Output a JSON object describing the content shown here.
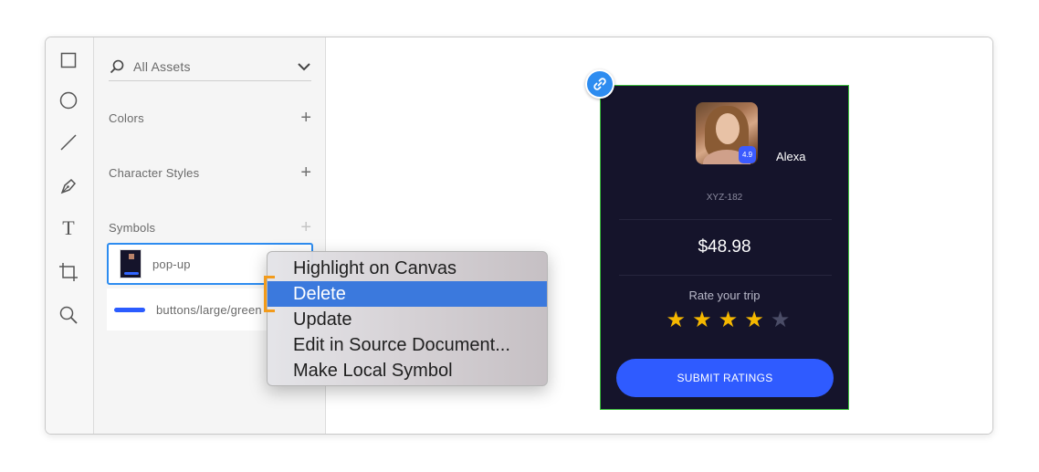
{
  "toolbar": {
    "tools": [
      {
        "name": "rectangle-tool",
        "icon": "rectangle-icon"
      },
      {
        "name": "ellipse-tool",
        "icon": "ellipse-icon"
      },
      {
        "name": "line-tool",
        "icon": "line-icon"
      },
      {
        "name": "pen-tool",
        "icon": "pen-icon"
      },
      {
        "name": "text-tool",
        "icon": "text-icon"
      },
      {
        "name": "artboard-tool",
        "icon": "artboard-icon"
      },
      {
        "name": "zoom-tool",
        "icon": "zoom-icon"
      }
    ],
    "text_tool_glyph": "T"
  },
  "assets": {
    "search_label": "All Assets",
    "colors_title": "Colors",
    "character_styles_title": "Character Styles",
    "symbols_title": "Symbols",
    "add_glyph": "+",
    "symbols": [
      {
        "name": "pop-up"
      },
      {
        "name": "buttons/large/green"
      }
    ]
  },
  "context_menu": {
    "items": [
      {
        "label": "Highlight on Canvas"
      },
      {
        "label": "Delete"
      },
      {
        "label": "Update"
      },
      {
        "label": "Edit in Source Document..."
      },
      {
        "label": "Make Local Symbol"
      }
    ],
    "highlighted": "Delete"
  },
  "card": {
    "rating_badge": "4.9",
    "user_name": "Alexa",
    "user_id": "XYZ-182",
    "price": "$48.98",
    "rate_label": "Rate your trip",
    "star_glyph": "★",
    "rating": 4,
    "rating_max": 5,
    "submit_label": "SUBMIT RATINGS"
  },
  "colors": {
    "accent": "#2d8cf0",
    "menu_highlight": "#3b79dd",
    "card_bg": "#15142b",
    "button_blue": "#2f5bff",
    "star_filled": "#f5b800",
    "star_empty": "#4a4c66",
    "artboard_border": "#3bbf3b",
    "annotation_orange": "#f29b1c"
  }
}
